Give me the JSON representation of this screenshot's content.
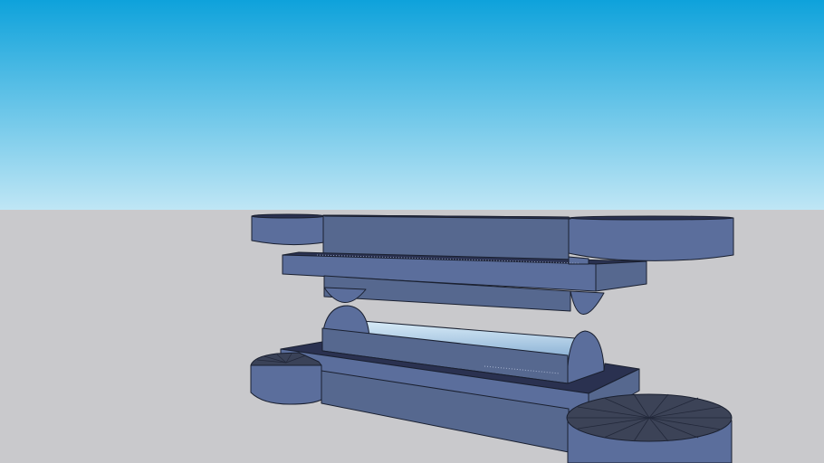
{
  "scene": {
    "subject": "3d-model-render",
    "colors": {
      "sky_top": "#0ea2db",
      "sky_bottom": "#bfe6f5",
      "ground": "#c9c9cc",
      "model_face": "#5b6e9c",
      "model_top": "#4f6090",
      "model_dark": "#26304f",
      "model_edge": "#1a2030",
      "glass": "#b9d6ee"
    }
  }
}
